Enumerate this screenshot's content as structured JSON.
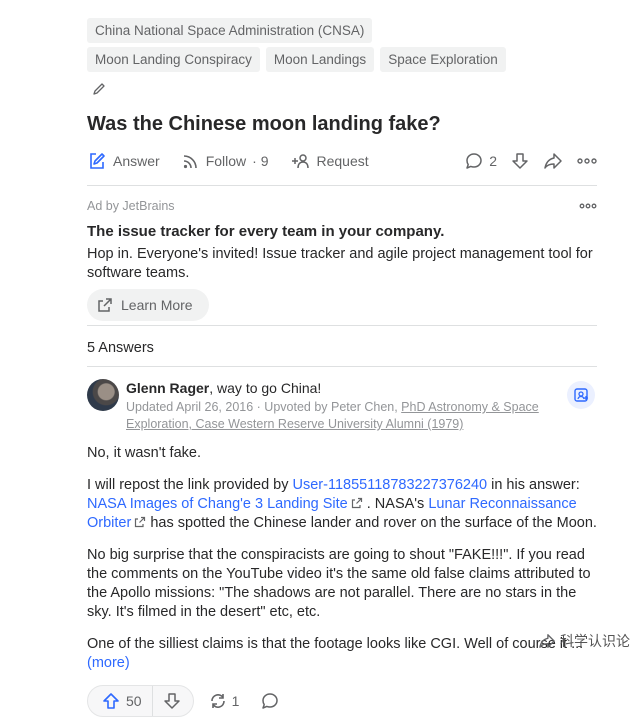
{
  "topics": [
    "China National Space Administration (CNSA)",
    "Moon Landing Conspiracy",
    "Moon Landings",
    "Space Exploration"
  ],
  "question": {
    "title": "Was the Chinese moon landing fake?",
    "answer_label": "Answer",
    "follow_label": "Follow",
    "follow_count": "· 9",
    "request_label": "Request",
    "comment_count": "2"
  },
  "ad": {
    "sponsor": "Ad by JetBrains",
    "title": "The issue tracker for every team in your company.",
    "body": "Hop in. Everyone's invited! Issue tracker and agile project management tool for software teams.",
    "cta": "Learn More"
  },
  "answers_count": "5 Answers",
  "answer": {
    "author": "Glenn Rager",
    "tagline": ", way to go China!",
    "meta_prefix": "Updated April 26, 2016 · Upvoted by Peter Chen, ",
    "meta_credential": "PhD Astronomy & Space Exploration, Case Western Reserve University Alumni (1979)",
    "p1": "No, it wasn't fake.",
    "p2_a": "I will repost the link provided by ",
    "p2_user": "User-11855118783227376240",
    "p2_b": " in his answer: ",
    "p2_link1": "NASA Images of Chang'e 3 Landing Site",
    "p2_c": " . NASA's ",
    "p2_link2a": "Lunar Reconnaissance",
    "p2_link2b": "Orbiter",
    "p2_d": " has spotted the Chinese lander and rover on the surface of the Moon.",
    "p3": "No big surprise that the conspiracists are going to shout \"FAKE!!!\". If you read the comments on the YouTube video it's the same old false claims attributed to the Apollo missions: \"The shadows are not parallel. There are no stars in the sky. It's filmed in the desert\" etc, etc.",
    "p4": "One of the silliest claims is that the footage looks like CGI. Well of course it ...",
    "more": "(more)",
    "upvotes": "50",
    "shares": "1"
  },
  "watermark": "科学认识论",
  "colors": {
    "link": "#2e69ff",
    "text": "#282829",
    "muted": "#636466",
    "faint": "#939598",
    "chip_bg": "#f1f2f2",
    "divider": "#dee0e1"
  },
  "icons": {
    "edit": "pencil-icon",
    "answer": "answer-pencil-square-icon",
    "follow": "follow-wifi-icon",
    "request": "request-person-plus-icon",
    "comment": "comment-bubble-icon",
    "downvote": "downvote-arrow-icon",
    "share": "share-arrow-icon",
    "more": "more-dots-icon",
    "external": "external-link-icon",
    "upvote": "upvote-arrow-icon",
    "reshare": "reshare-cycle-icon",
    "follow_author": "follow-author-icon"
  }
}
